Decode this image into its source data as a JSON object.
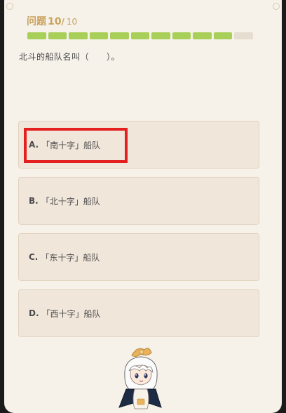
{
  "header": {
    "label": "问题",
    "current": "10",
    "separator": "/",
    "total": "10"
  },
  "progress": {
    "filled": 10,
    "total": 11
  },
  "question": {
    "text": "北斗的船队名叫（　　）。"
  },
  "options": [
    {
      "key": "A.",
      "text": "「南十字」船队"
    },
    {
      "key": "B.",
      "text": "「北十字」船队"
    },
    {
      "key": "C.",
      "text": "「东十字」船队"
    },
    {
      "key": "D.",
      "text": "「西十字」船队"
    }
  ],
  "colors": {
    "accent": "#c9a25c",
    "progress_filled": "#a8cf57",
    "progress_empty": "#e4ddd0",
    "highlight": "#e41f1f",
    "card": "#f6f1e9",
    "option_bg": "#f1e6da"
  },
  "icons": {
    "mascot": "paimon-mascot-icon"
  }
}
